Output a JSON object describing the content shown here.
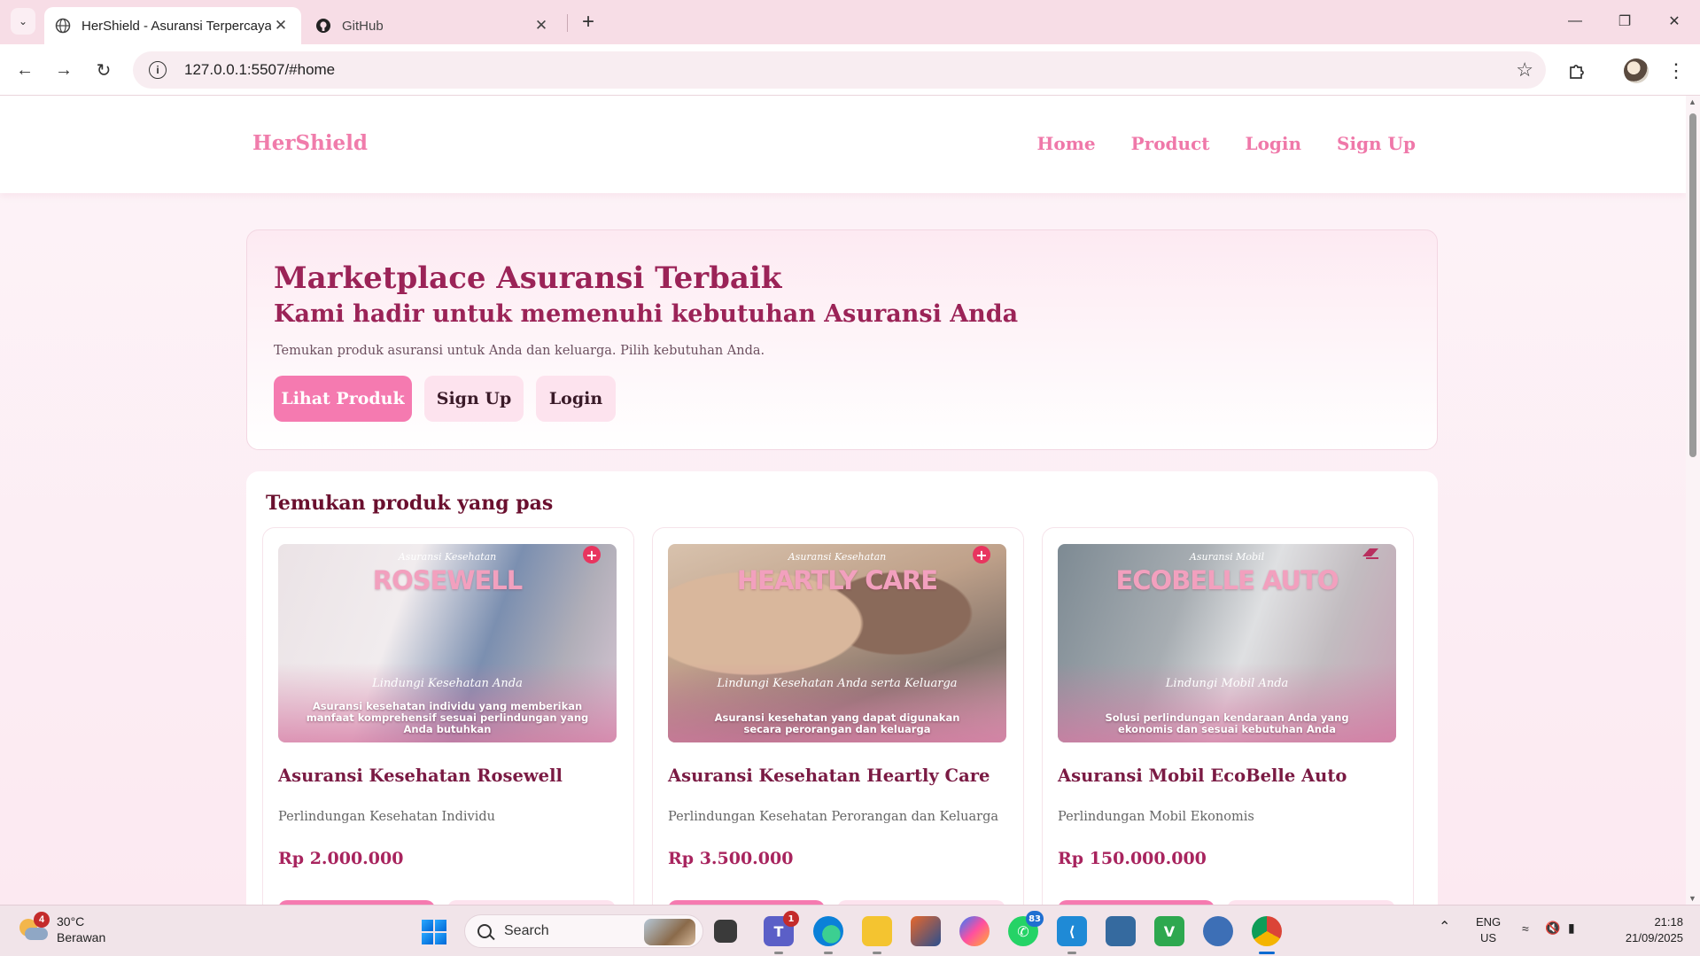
{
  "browser": {
    "tabs": [
      {
        "title": "HerShield - Asuransi Terpercaya",
        "active": true
      },
      {
        "title": "GitHub",
        "active": false
      }
    ],
    "url": "127.0.0.1:5507/#home"
  },
  "site": {
    "brand": "HerShield",
    "nav": [
      "Home",
      "Product",
      "Login",
      "Sign Up"
    ],
    "accent_color": "#f57ab0",
    "heading_color": "#9b2357"
  },
  "hero": {
    "title": "Marketplace Asuransi Terbaik",
    "subtitle": "Kami hadir untuk memenuhi kebutuhan Asuransi Anda",
    "description": "Temukan produk asuransi untuk Anda dan keluarga. Pilih kebutuhan Anda.",
    "buttons": [
      "Lihat Produk",
      "Sign Up",
      "Login"
    ]
  },
  "products": {
    "heading": "Temukan produk yang pas",
    "items": [
      {
        "image_brand": "ROSEWELL",
        "image_script_top": "Asuransi Kesehatan",
        "image_script_mid": "Lindungi Kesehatan Anda",
        "image_tagline": "Asuransi kesehatan individu yang memberikan manfaat komprehensif sesuai perlindungan yang Anda butuhkan",
        "title": "Asuransi Kesehatan Rosewell",
        "description": "Perlindungan Kesehatan Individu",
        "price": "Rp 2.000.000"
      },
      {
        "image_brand": "HEARTLY CARE",
        "image_script_top": "Asuransi Kesehatan",
        "image_script_mid": "Lindungi Kesehatan Anda serta Keluarga",
        "image_tagline": "Asuransi kesehatan yang dapat digunakan secara perorangan dan keluarga",
        "title": "Asuransi Kesehatan Heartly Care",
        "description": "Perlindungan Kesehatan Perorangan dan Keluarga",
        "price": "Rp 3.500.000"
      },
      {
        "image_brand": "ECOBELLE AUTO",
        "image_script_top": "Asuransi Mobil",
        "image_script_mid": "Lindungi Mobil Anda",
        "image_tagline": "Solusi perlindungan kendaraan Anda yang ekonomis dan sesuai kebutuhan Anda",
        "title": "Asuransi Mobil EcoBelle Auto",
        "description": "Perlindungan Mobil Ekonomis",
        "price": "Rp 150.000.000"
      }
    ]
  },
  "taskbar": {
    "weather_temp": "30°C",
    "weather_desc": "Berawan",
    "weather_badge": "4",
    "search_placeholder": "Search",
    "teams_badge": "1",
    "whatsapp_badge": "83",
    "lang_1": "ENG",
    "lang_2": "US",
    "time": "21:18",
    "date": "21/09/2025"
  }
}
